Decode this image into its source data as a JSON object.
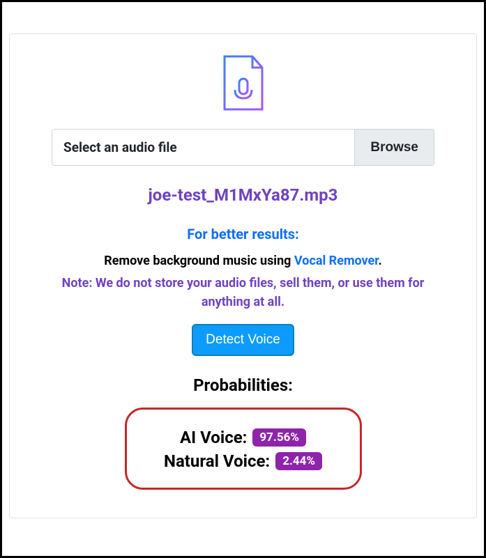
{
  "file_input": {
    "placeholder": "Select an audio file",
    "browse_label": "Browse"
  },
  "filename": "joe-test_M1MxYa87.mp3",
  "tips": {
    "heading": "For better results:",
    "remove_bg_prefix": "Remove background music using ",
    "vocal_remover_link": "Vocal Remover",
    "remove_bg_suffix": ".",
    "note": "Note: We do not store your audio files, sell them, or use them for anything at all."
  },
  "detect_button": "Detect Voice",
  "probabilities": {
    "heading": "Probabilities:",
    "ai_voice_label": "AI Voice:",
    "ai_voice_value": "97.56%",
    "natural_voice_label": "Natural Voice:",
    "natural_voice_value": "2.44%"
  }
}
